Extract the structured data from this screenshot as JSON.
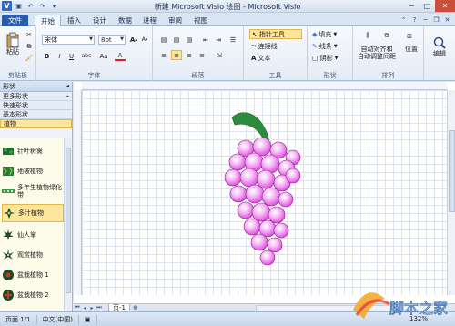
{
  "window": {
    "title": "新建 Microsoft Visio 绘图 - Microsoft Visio",
    "app_logo": "V"
  },
  "tabs": [
    "文件",
    "开始",
    "插入",
    "设计",
    "数据",
    "进程",
    "审阅",
    "视图"
  ],
  "ribbon": {
    "clipboard": {
      "paste_label": "粘贴",
      "group_label": "剪贴板"
    },
    "font": {
      "font_name": "宋体",
      "font_size": "8pt",
      "grow_label": "A",
      "shrink_label": "A",
      "bold": "B",
      "italic": "I",
      "underline": "U",
      "strike": "abc",
      "case_label": "Aa",
      "color_label": "A",
      "group_label": "字体"
    },
    "paragraph": {
      "group_label": "段落"
    },
    "tools": {
      "pointer_label": "指针工具",
      "connector_label": "连接线",
      "text_label": "文本",
      "group_label": "工具"
    },
    "shape": {
      "fill_label": "填充",
      "line_label": "线条",
      "shadow_label": "阴影",
      "group_label": "形状"
    },
    "arrange": {
      "auto_align_label_1": "自动对齐和",
      "auto_align_label_2": "自动调整间距",
      "position_label": "位置",
      "group_label": "排列"
    },
    "edit": {
      "label": "编辑"
    }
  },
  "shapes_panel": {
    "title": "形状",
    "categories": [
      {
        "label": "更多形状",
        "selected": false
      },
      {
        "label": "快速形状",
        "selected": false
      },
      {
        "label": "基本形状",
        "selected": false
      },
      {
        "label": "植物",
        "selected": true
      }
    ],
    "items": [
      {
        "label": "针叶树篱",
        "icon": "hedge-icon",
        "selected": false
      },
      {
        "label": "地被植物",
        "icon": "groundcover-icon",
        "selected": false
      },
      {
        "label": "多年生植物绿化带",
        "icon": "perennial-icon",
        "selected": false
      },
      {
        "label": "多汁植物",
        "icon": "succulent-icon",
        "selected": true
      },
      {
        "label": "仙人掌",
        "icon": "cactus-icon",
        "selected": false
      },
      {
        "label": "观赏植物",
        "icon": "ornamental-icon",
        "selected": false
      },
      {
        "label": "盆栽植物 1",
        "icon": "potted-plant-icon",
        "selected": false
      },
      {
        "label": "盆栽植物 2",
        "icon": "potted-plant-icon",
        "selected": false
      }
    ]
  },
  "canvas": {
    "page_tab": "页-1",
    "leaf_color": "#2e8b3e",
    "grape_color": "#e33be0"
  },
  "status": {
    "page": "页面 1/1",
    "language": "中文(中国)",
    "zoom": "132%"
  },
  "watermark": {
    "text": "脚本之家"
  }
}
